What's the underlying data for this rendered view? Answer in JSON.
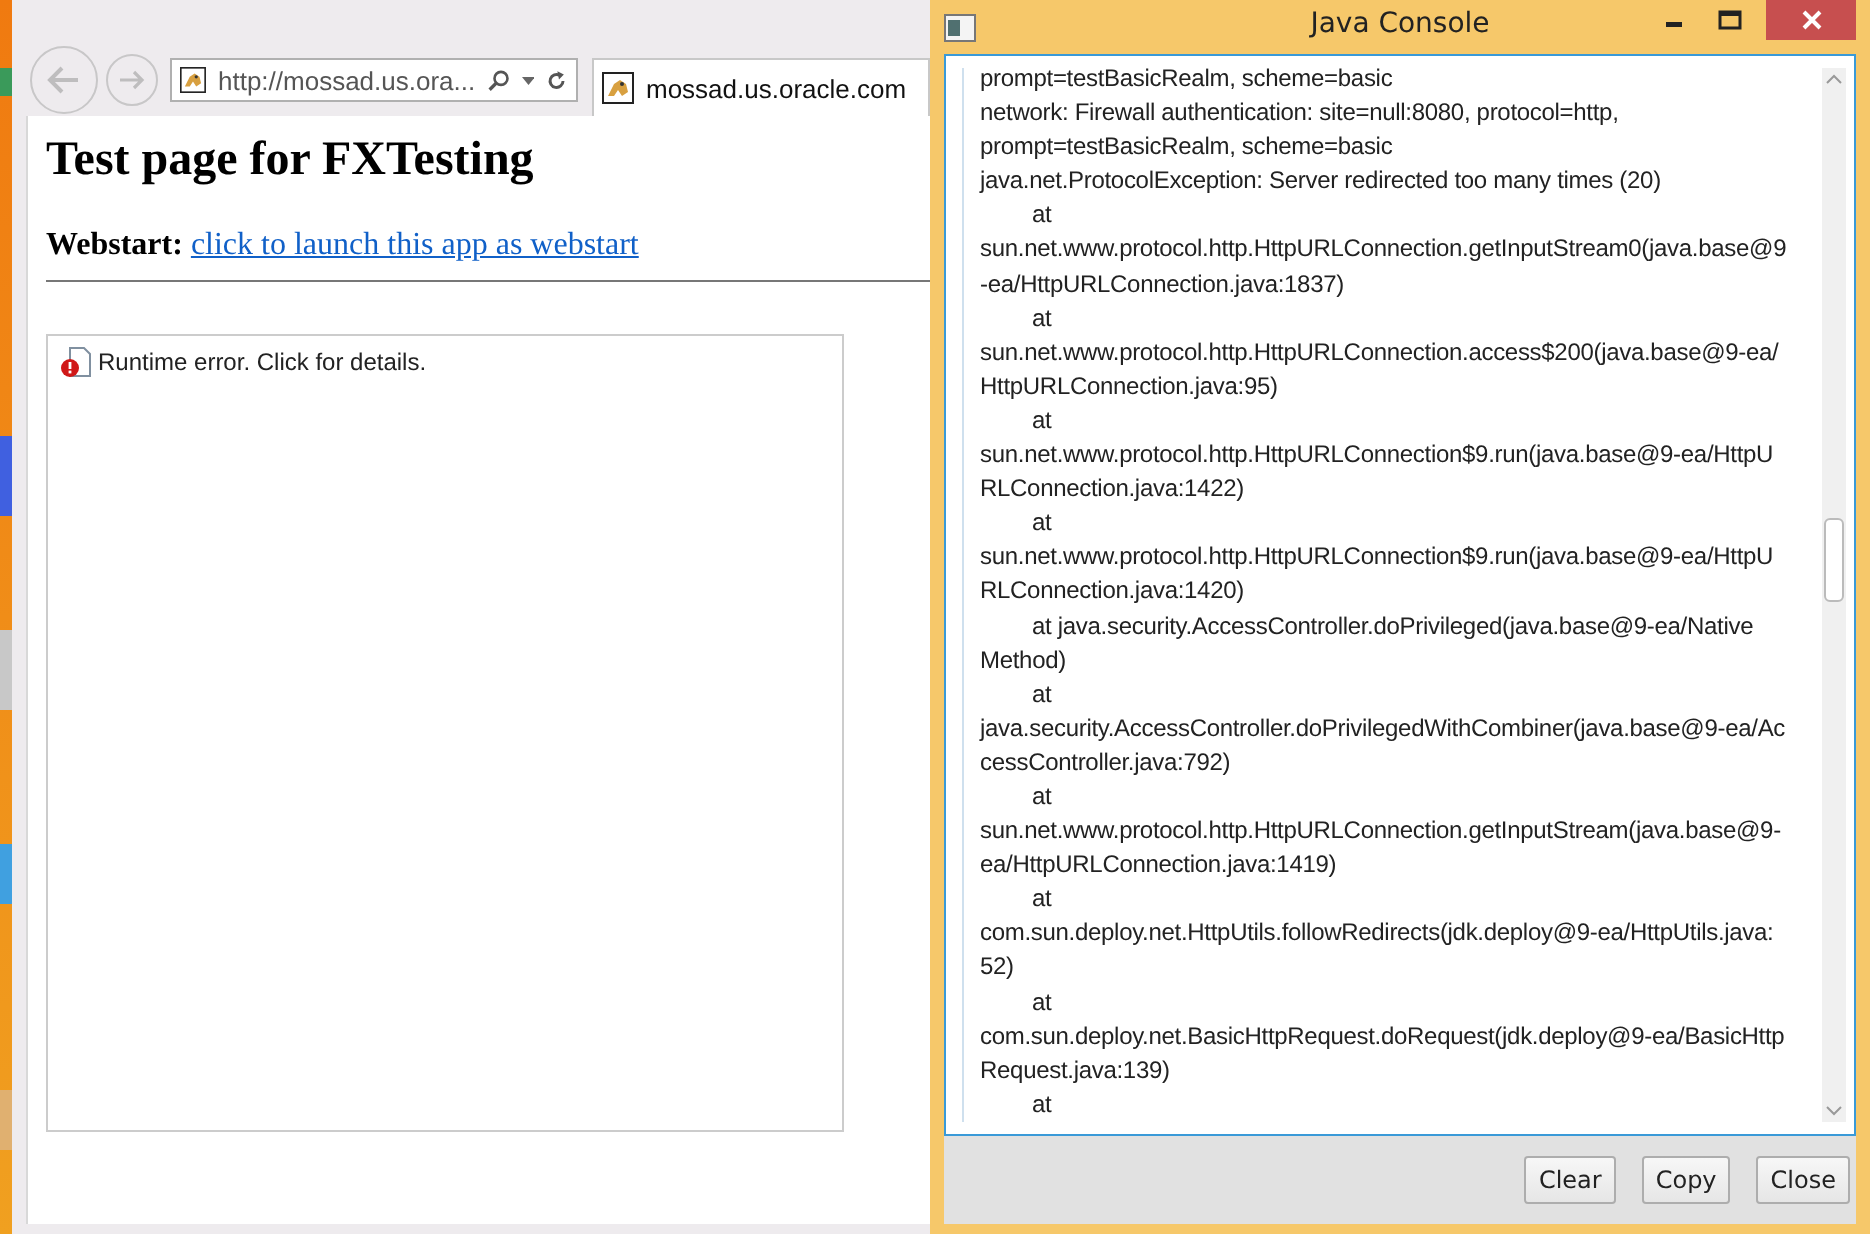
{
  "browser": {
    "back_enabled": false,
    "forward_enabled": false,
    "address": "http://mossad.us.ora...",
    "tab_title": "mossad.us.oracle.com",
    "page": {
      "heading": "Test page for FXTesting",
      "label": "Webstart:",
      "link": "click to launch this app as webstart",
      "applet_message": "Runtime error. Click for details."
    }
  },
  "console": {
    "title": "Java Console",
    "lines": [
      {
        "kind": "plain",
        "text": "prompt=testBasicRealm, scheme=basic"
      },
      {
        "kind": "plain",
        "text": "network: Firewall authentication: site=null:8080, protocol=http,"
      },
      {
        "kind": "plain",
        "text": "prompt=testBasicRealm, scheme=basic"
      },
      {
        "kind": "plain",
        "text": "java.net.ProtocolException: Server redirected too many  times (20)"
      },
      {
        "kind": "indented",
        "text": "at"
      },
      {
        "kind": "plain",
        "text": "sun.net.www.protocol.http.HttpURLConnection.getInputStream0(java.base@9"
      },
      {
        "kind": "plain",
        "text": "-ea/HttpURLConnection.java:1837)"
      },
      {
        "kind": "indented",
        "text": "at"
      },
      {
        "kind": "plain",
        "text": "sun.net.www.protocol.http.HttpURLConnection.access$200(java.base@9-ea/"
      },
      {
        "kind": "plain",
        "text": "HttpURLConnection.java:95)"
      },
      {
        "kind": "indented",
        "text": "at"
      },
      {
        "kind": "plain",
        "text": "sun.net.www.protocol.http.HttpURLConnection$9.run(java.base@9-ea/HttpU"
      },
      {
        "kind": "plain",
        "text": "RLConnection.java:1422)"
      },
      {
        "kind": "indented",
        "text": "at"
      },
      {
        "kind": "plain",
        "text": "sun.net.www.protocol.http.HttpURLConnection$9.run(java.base@9-ea/HttpU"
      },
      {
        "kind": "plain",
        "text": "RLConnection.java:1420)"
      },
      {
        "kind": "indented",
        "text": "at java.security.AccessController.doPrivileged(java.base@9-ea/Native"
      },
      {
        "kind": "plain",
        "text": "Method)"
      },
      {
        "kind": "indented",
        "text": "at"
      },
      {
        "kind": "plain",
        "text": "java.security.AccessController.doPrivilegedWithCombiner(java.base@9-ea/Ac"
      },
      {
        "kind": "plain",
        "text": "cessController.java:792)"
      },
      {
        "kind": "indented",
        "text": "at"
      },
      {
        "kind": "plain",
        "text": "sun.net.www.protocol.http.HttpURLConnection.getInputStream(java.base@9-"
      },
      {
        "kind": "plain",
        "text": "ea/HttpURLConnection.java:1419)"
      },
      {
        "kind": "indented",
        "text": "at"
      },
      {
        "kind": "plain",
        "text": "com.sun.deploy.net.HttpUtils.followRedirects(jdk.deploy@9-ea/HttpUtils.java:"
      },
      {
        "kind": "plain",
        "text": "52)"
      },
      {
        "kind": "indented",
        "text": "at"
      },
      {
        "kind": "plain",
        "text": "com.sun.deploy.net.BasicHttpRequest.doRequest(jdk.deploy@9-ea/BasicHttp"
      },
      {
        "kind": "plain",
        "text": "Request.java:139)"
      },
      {
        "kind": "indented",
        "text": "at"
      }
    ],
    "buttons": [
      "Clear",
      "Copy",
      "Close"
    ]
  }
}
